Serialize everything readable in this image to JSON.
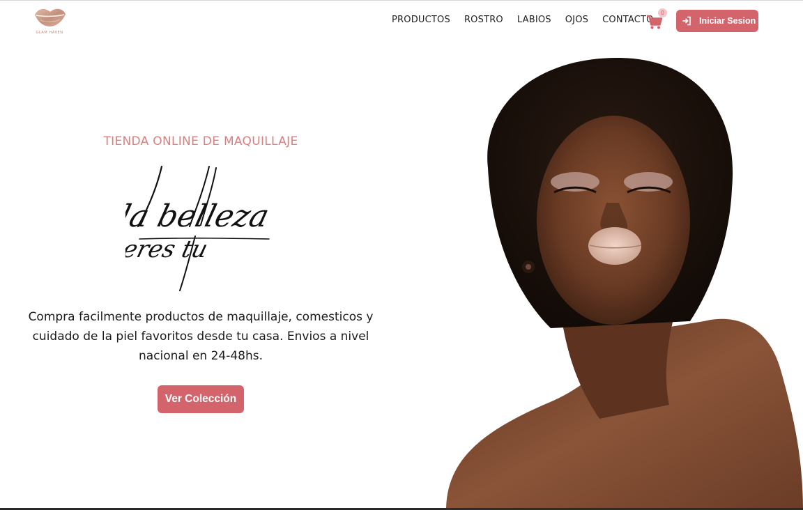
{
  "navbar": {
    "logo_text": "GLAM HAVEN",
    "links": [
      "PRODUCTOS",
      "ROSTRO",
      "LABIOS",
      "OJOS",
      "CONTACTO"
    ],
    "cart_count": "0",
    "login_label": "Iniciar Sesion"
  },
  "hero": {
    "eyebrow": "TIENDA ONLINE DE MAQUILLAJE",
    "script_line_1": "la belleza",
    "script_line_2": "eres tu",
    "description": "Compra facilmente productos de maquillaje, comesticos y cuidado de la piel favoritos desde tu casa. Envios a nivel nacional en 24-48hs.",
    "cta_label": "Ver Colección"
  },
  "icons": {
    "logo": "lips-logo-icon",
    "cart": "shopping-cart-icon",
    "login": "sign-in-icon"
  },
  "colors": {
    "accent": "#d4646c",
    "eyebrow": "#d98080",
    "logo": "#c89a88"
  }
}
